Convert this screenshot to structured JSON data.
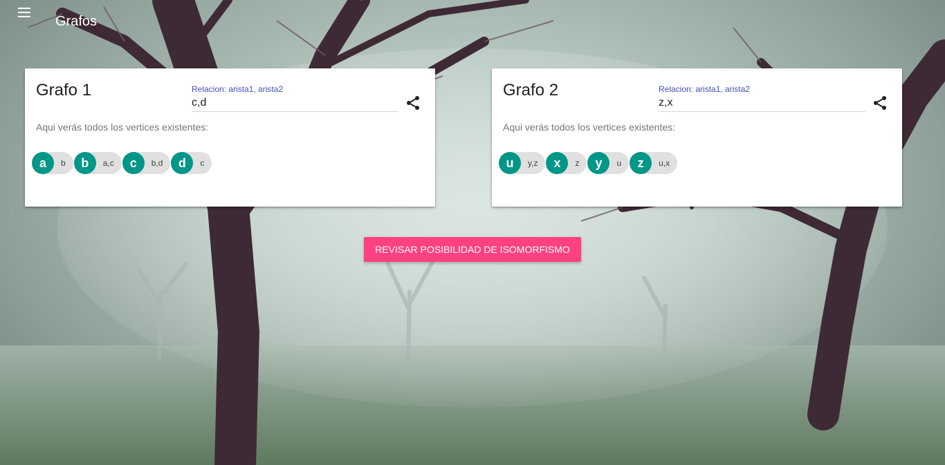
{
  "app": {
    "title": "Grafos",
    "menu_icon": "menu-icon"
  },
  "graphs": [
    {
      "title": "Grafo 1",
      "relation_label": "Relacion: arista1, arista2",
      "relation_value": "c,d",
      "share_icon": "share-icon",
      "hint": "Aqui verás todos los vertices existentes:",
      "vertices": [
        {
          "name": "a",
          "adjacent": "b"
        },
        {
          "name": "b",
          "adjacent": "a,c"
        },
        {
          "name": "c",
          "adjacent": "b,d"
        },
        {
          "name": "d",
          "adjacent": "c"
        }
      ]
    },
    {
      "title": "Grafo 2",
      "relation_label": "Relacion: arista1, arista2",
      "relation_value": "z,x",
      "share_icon": "share-icon",
      "hint": "Aqui verás todos los vertices existentes:",
      "vertices": [
        {
          "name": "u",
          "adjacent": "y,z"
        },
        {
          "name": "x",
          "adjacent": "z"
        },
        {
          "name": "y",
          "adjacent": "u"
        },
        {
          "name": "z",
          "adjacent": "u,x"
        }
      ]
    }
  ],
  "actions": {
    "check_isomorphism": "REVISAR POSIBILIDAD DE ISOMORFISMO"
  },
  "colors": {
    "accent": "#ff4081",
    "vertex": "#009688",
    "label": "#3f51b5"
  }
}
